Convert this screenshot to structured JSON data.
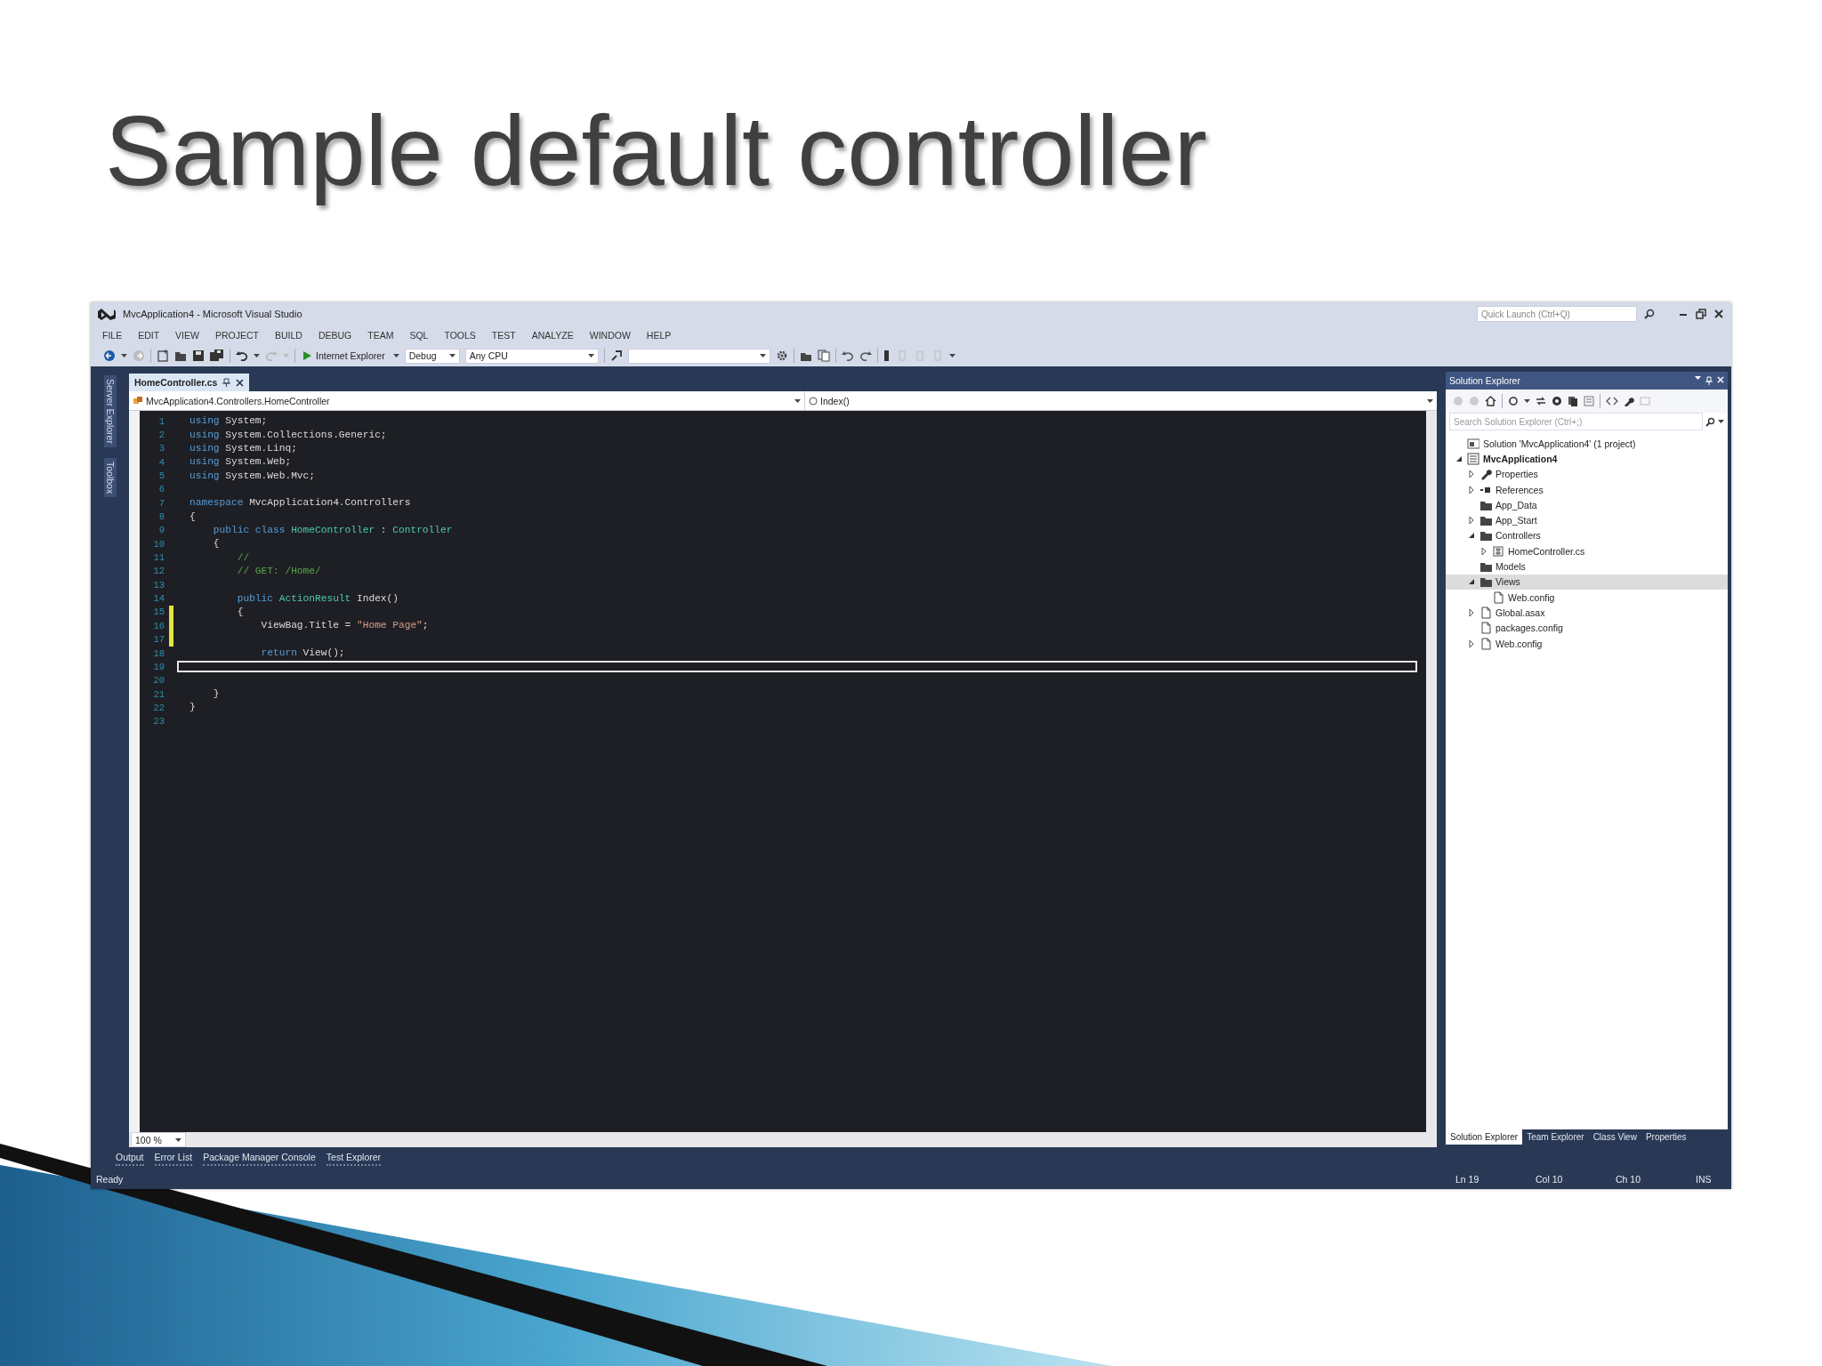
{
  "slide_title": "Sample default controller",
  "window": {
    "title": "MvcApplication4 - Microsoft Visual Studio",
    "quick_launch": {
      "placeholder": "Quick Launch (Ctrl+Q)"
    }
  },
  "menu": [
    "FILE",
    "EDIT",
    "VIEW",
    "PROJECT",
    "BUILD",
    "DEBUG",
    "TEAM",
    "SQL",
    "TOOLS",
    "TEST",
    "ANALYZE",
    "WINDOW",
    "HELP"
  ],
  "toolbar": {
    "run_target": "Internet Explorer",
    "configuration": "Debug",
    "platform": "Any CPU"
  },
  "left_strip": [
    "Server Explorer",
    "Toolbox"
  ],
  "editor": {
    "tabs": [
      {
        "label": "HomeController.cs",
        "selected": true
      }
    ],
    "type_dropdown": "MvcApplication4.Controllers.HomeController",
    "member_dropdown": "Index()",
    "zoom": "100 %",
    "lines": [
      {
        "number": "1",
        "changed": false,
        "current": false,
        "tokens": [
          {
            "kind": "keyword",
            "text": "using"
          },
          {
            "kind": "plain",
            "text": " System;"
          }
        ]
      },
      {
        "number": "2",
        "changed": false,
        "current": false,
        "tokens": [
          {
            "kind": "keyword",
            "text": "using"
          },
          {
            "kind": "plain",
            "text": " System.Collections.Generic;"
          }
        ]
      },
      {
        "number": "3",
        "changed": false,
        "current": false,
        "tokens": [
          {
            "kind": "keyword",
            "text": "using"
          },
          {
            "kind": "plain",
            "text": " System.Linq;"
          }
        ]
      },
      {
        "number": "4",
        "changed": false,
        "current": false,
        "tokens": [
          {
            "kind": "keyword",
            "text": "using"
          },
          {
            "kind": "plain",
            "text": " System.Web;"
          }
        ]
      },
      {
        "number": "5",
        "changed": false,
        "current": false,
        "tokens": [
          {
            "kind": "keyword",
            "text": "using"
          },
          {
            "kind": "plain",
            "text": " System.Web.Mvc;"
          }
        ]
      },
      {
        "number": "6",
        "changed": false,
        "current": false
      },
      {
        "number": "7",
        "changed": false,
        "current": false,
        "tokens": [
          {
            "kind": "keyword",
            "text": "namespace"
          },
          {
            "kind": "plain",
            "text": " MvcApplication4.Controllers"
          }
        ]
      },
      {
        "number": "8",
        "changed": false,
        "current": false,
        "tokens": [
          {
            "kind": "plain",
            "text": "{"
          }
        ]
      },
      {
        "number": "9",
        "changed": false,
        "current": false,
        "tokens": [
          {
            "kind": "keyword",
            "text": "    public class"
          },
          {
            "kind": "type",
            "text": " HomeController"
          },
          {
            "kind": "plain",
            "text": " : "
          },
          {
            "kind": "type",
            "text": "Controller"
          }
        ]
      },
      {
        "number": "10",
        "changed": false,
        "current": false,
        "tokens": [
          {
            "kind": "plain",
            "text": "    {"
          }
        ]
      },
      {
        "number": "11",
        "changed": false,
        "current": false,
        "tokens": [
          {
            "kind": "comment",
            "text": "        //"
          }
        ]
      },
      {
        "number": "12",
        "changed": false,
        "current": false,
        "tokens": [
          {
            "kind": "comment",
            "text": "        // GET: /Home/"
          }
        ]
      },
      {
        "number": "13",
        "changed": false,
        "current": false
      },
      {
        "number": "14",
        "changed": false,
        "current": false,
        "tokens": [
          {
            "kind": "keyword",
            "text": "        public"
          },
          {
            "kind": "type",
            "text": " ActionResult"
          },
          {
            "kind": "plain",
            "text": " Index()"
          }
        ]
      },
      {
        "number": "15",
        "changed": true,
        "current": false,
        "tokens": [
          {
            "kind": "plain",
            "text": "        {"
          }
        ]
      },
      {
        "number": "16",
        "changed": true,
        "current": false,
        "tokens": [
          {
            "kind": "plain",
            "text": "            ViewBag.Title = "
          },
          {
            "kind": "string",
            "text": "\"Home Page\""
          },
          {
            "kind": "plain",
            "text": ";"
          }
        ]
      },
      {
        "number": "17",
        "changed": true,
        "current": false
      },
      {
        "number": "18",
        "changed": false,
        "current": false,
        "tokens": [
          {
            "kind": "keyword",
            "text": "            return"
          },
          {
            "kind": "plain",
            "text": " View();"
          }
        ]
      },
      {
        "number": "19",
        "changed": false,
        "current": true
      },
      {
        "number": "20",
        "changed": false,
        "current": false
      },
      {
        "number": "21",
        "changed": false,
        "current": false,
        "tokens": [
          {
            "kind": "plain",
            "text": "    }"
          }
        ]
      },
      {
        "number": "22",
        "changed": false,
        "current": false,
        "tokens": [
          {
            "kind": "plain",
            "text": "}"
          }
        ]
      },
      {
        "number": "23",
        "changed": false,
        "current": false
      }
    ]
  },
  "solution_explorer": {
    "title": "Solution Explorer",
    "search": {
      "placeholder": "Search Solution Explorer (Ctrl+;)"
    },
    "tree": [
      {
        "label": "Solution 'MvcApplication4' (1 project)",
        "kind": "solution",
        "expandable": false,
        "selected": false
      },
      {
        "label": "MvcApplication4",
        "kind": "project",
        "expandable": true,
        "expanded": true,
        "selected": false,
        "children": [
          {
            "label": "Properties",
            "kind": "properties",
            "expandable": true,
            "expanded": false,
            "selected": false
          },
          {
            "label": "References",
            "kind": "references",
            "expandable": true,
            "expanded": false,
            "selected": false
          },
          {
            "label": "App_Data",
            "kind": "folder",
            "expandable": false,
            "selected": false
          },
          {
            "label": "App_Start",
            "kind": "folder",
            "expandable": true,
            "expanded": false,
            "selected": false
          },
          {
            "label": "Controllers",
            "kind": "folder",
            "expandable": true,
            "expanded": true,
            "selected": false,
            "children": [
              {
                "label": "HomeController.cs",
                "kind": "source",
                "expandable": true,
                "expanded": false,
                "selected": false
              }
            ]
          },
          {
            "label": "Models",
            "kind": "folder",
            "expandable": false,
            "selected": false
          },
          {
            "label": "Views",
            "kind": "folder",
            "expandable": true,
            "expanded": true,
            "selected": true,
            "children": [
              {
                "label": "Web.config",
                "kind": "file",
                "expandable": false,
                "selected": false
              }
            ]
          },
          {
            "label": "Global.asax",
            "kind": "file",
            "expandable": true,
            "expanded": false,
            "selected": false
          },
          {
            "label": "packages.config",
            "kind": "file",
            "expandable": false,
            "selected": false
          },
          {
            "label": "Web.config",
            "kind": "file",
            "expandable": true,
            "expanded": false,
            "selected": false
          }
        ]
      }
    ],
    "tabs": [
      {
        "label": "Solution Explorer",
        "selected": true
      },
      {
        "label": "Team Explorer",
        "selected": false
      },
      {
        "label": "Class View",
        "selected": false
      },
      {
        "label": "Properties",
        "selected": false
      }
    ]
  },
  "tool_tabs": [
    "Output",
    "Error List",
    "Package Manager Console",
    "Test Explorer"
  ],
  "status_bar": {
    "message": "Ready",
    "line": "Ln 19",
    "column": "Col 10",
    "char": "Ch 10",
    "mode": "INS"
  }
}
